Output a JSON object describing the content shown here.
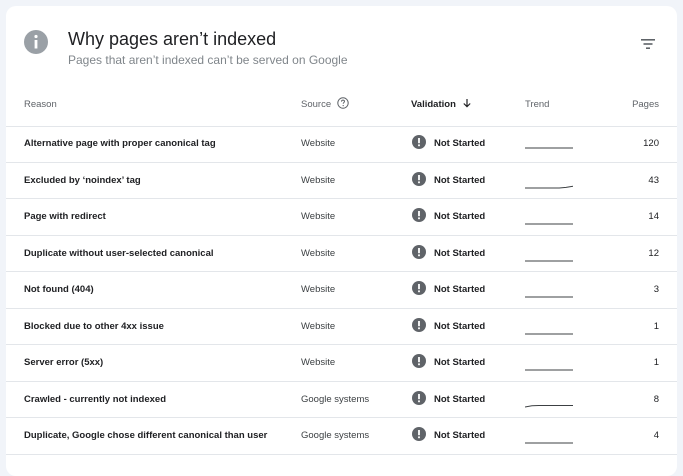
{
  "panel": {
    "title": "Why pages aren’t indexed",
    "subtitle": "Pages that aren’t indexed can’t be served on Google"
  },
  "table": {
    "headers": {
      "reason": "Reason",
      "source": "Source",
      "validation": "Validation",
      "trend": "Trend",
      "pages": "Pages"
    },
    "rows": [
      {
        "reason": "Alternative page with proper canonical tag",
        "source": "Website",
        "validation": "Not Started",
        "trend": [
          1,
          1,
          1,
          1,
          1,
          1,
          1,
          1
        ],
        "pages": "120"
      },
      {
        "reason": "Excluded by ‘noindex’ tag",
        "source": "Website",
        "validation": "Not Started",
        "trend": [
          0,
          0,
          0,
          0,
          0,
          0,
          0.2,
          0.6
        ],
        "pages": "43"
      },
      {
        "reason": "Page with redirect",
        "source": "Website",
        "validation": "Not Started",
        "trend": [
          0,
          0,
          0,
          0,
          0,
          0,
          0,
          0
        ],
        "pages": "14"
      },
      {
        "reason": "Duplicate without user-selected canonical",
        "source": "Website",
        "validation": "Not Started",
        "trend": [
          0,
          0,
          0,
          0,
          0,
          0,
          0,
          0
        ],
        "pages": "12"
      },
      {
        "reason": "Not found (404)",
        "source": "Website",
        "validation": "Not Started",
        "trend": [
          0,
          0,
          0,
          0,
          0,
          0,
          0,
          0
        ],
        "pages": "3"
      },
      {
        "reason": "Blocked due to other 4xx issue",
        "source": "Website",
        "validation": "Not Started",
        "trend": [
          0,
          0,
          0,
          0,
          0,
          0,
          0,
          0
        ],
        "pages": "1"
      },
      {
        "reason": "Server error (5xx)",
        "source": "Website",
        "validation": "Not Started",
        "trend": [
          0,
          0,
          0,
          0,
          0,
          0,
          0,
          0
        ],
        "pages": "1"
      },
      {
        "reason": "Crawled - currently not indexed",
        "source": "Google systems",
        "validation": "Not Started",
        "trend": [
          0,
          0.4,
          0.5,
          0.5,
          0.5,
          0.5,
          0.5,
          0.5
        ],
        "pages": "8"
      },
      {
        "reason": "Duplicate, Google chose different canonical than user",
        "source": "Google systems",
        "validation": "Not Started",
        "trend": [
          0,
          0,
          0,
          0,
          0,
          0,
          0,
          0
        ],
        "pages": "4"
      }
    ]
  },
  "icons": {
    "info": "info-icon",
    "filter": "filter-icon",
    "help": "help-circle-icon",
    "sort": "arrow-down-icon",
    "status": "exclamation-circle-icon"
  },
  "colors": {
    "icon_gray": "#9aa0a6",
    "status_icon": "#5f6368",
    "trend_line": "#3c4043"
  }
}
